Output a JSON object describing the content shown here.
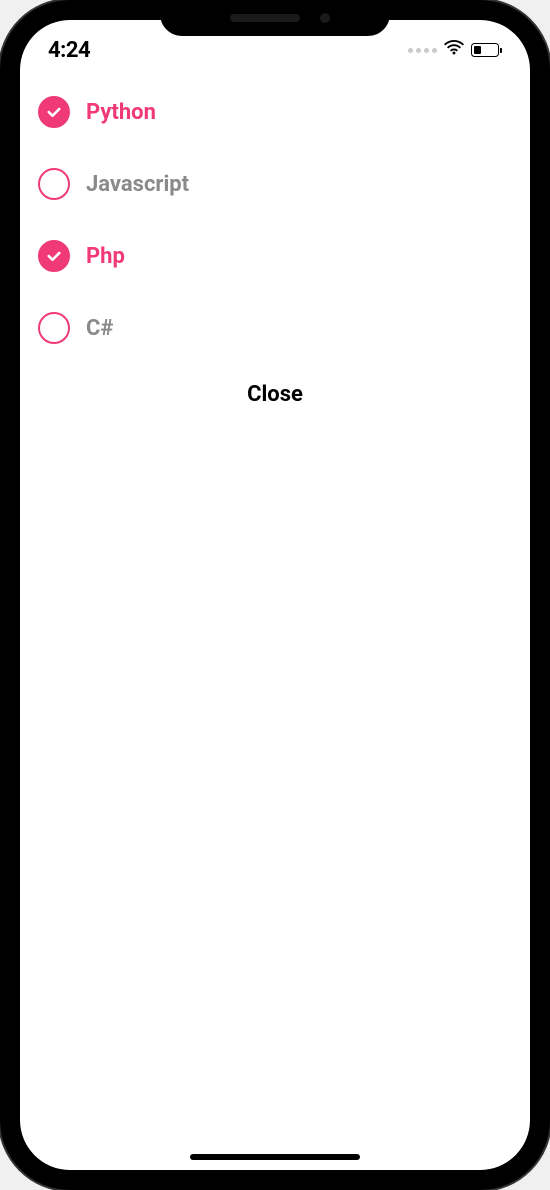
{
  "status_bar": {
    "time": "4:24"
  },
  "options": [
    {
      "label": "Python",
      "selected": true
    },
    {
      "label": "Javascript",
      "selected": false
    },
    {
      "label": "Php",
      "selected": true
    },
    {
      "label": "C#",
      "selected": false
    }
  ],
  "close_label": "Close",
  "colors": {
    "accent": "#f03a77",
    "unselected_text": "#8a8a8a"
  }
}
